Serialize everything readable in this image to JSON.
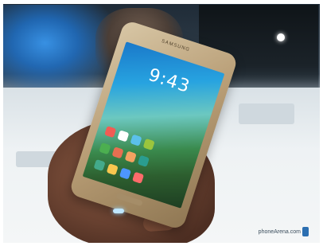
{
  "photo": {
    "subject": "hand-holding-smartphone",
    "phone": {
      "brand_text": "SAMSUNG",
      "clock_text": "9:43",
      "accent_colors": {
        "body": "#b79c74",
        "screen_sky": "#1a78c9",
        "screen_foliage": "#2d5f2f"
      }
    },
    "watermark": {
      "text": "phoneArena.com",
      "color": "#2c6fb1"
    }
  }
}
